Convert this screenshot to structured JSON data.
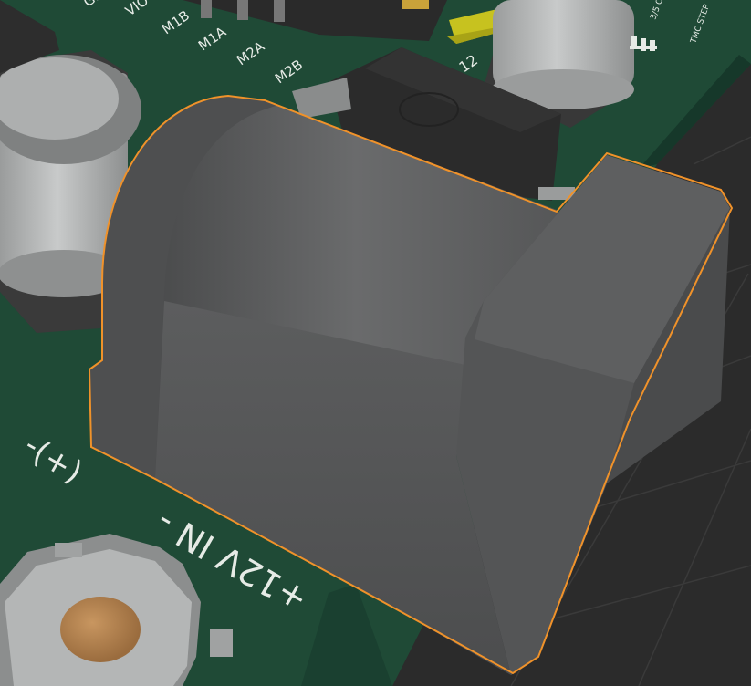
{
  "viewport": {
    "background_color": "#2b2b2b",
    "grid_color": "#3a3a3a",
    "pcb_color": "#1f4a36",
    "selection_color": "#f0922a",
    "jack_color": "#5a5b5c"
  },
  "silkscreen": {
    "gnd": "GN",
    "vio": "VIO",
    "m1b": "M1B",
    "m1a": "M1A",
    "m2a": "M2A",
    "m2b": "M2B",
    "num_12": "12",
    "right_a": "3/5 C",
    "right_b": "TMC STEP",
    "polarity": "(+)-",
    "power_in": "+12V IN -"
  },
  "selection": {
    "object": "barrel-jack"
  }
}
